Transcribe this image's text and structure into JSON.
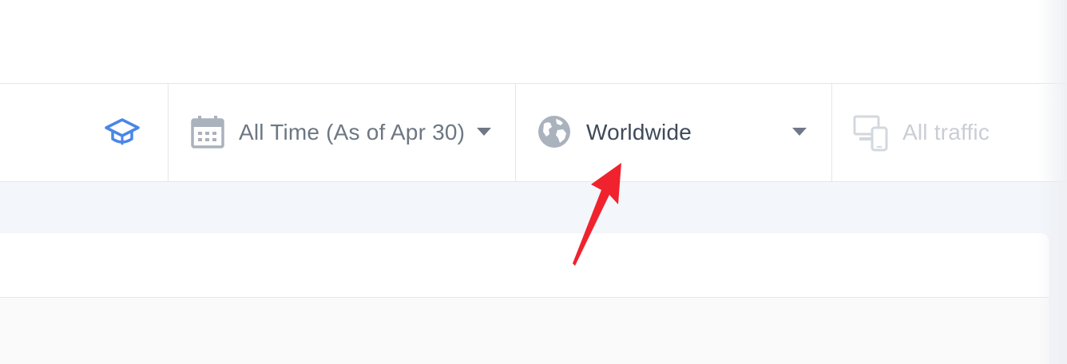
{
  "toolbar": {
    "learn_icon": "graduation-cap-icon",
    "date_filter": {
      "icon": "calendar-icon",
      "label": "All Time (As of Apr 30)"
    },
    "country_filter": {
      "icon": "globe-icon",
      "label": "Worldwide"
    },
    "traffic_filter": {
      "icon": "devices-icon",
      "label": "All traffic",
      "disabled": true
    }
  },
  "annotation": {
    "icon": "red-arrow-icon",
    "color": "#f0222e"
  },
  "colors": {
    "accent": "#4a86e8",
    "text_primary": "#3e4a5a",
    "text_secondary": "#6d7783",
    "text_disabled": "#c9ced5"
  }
}
